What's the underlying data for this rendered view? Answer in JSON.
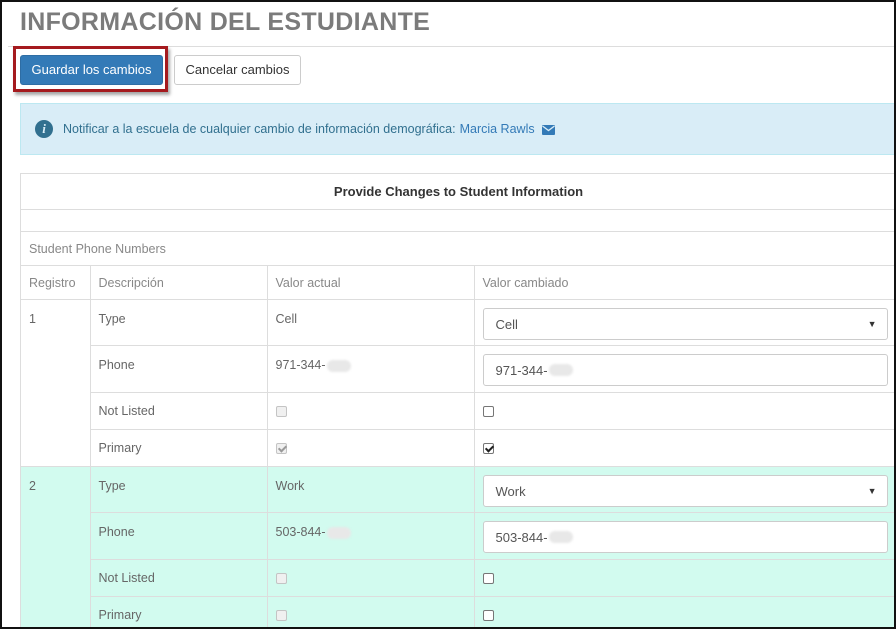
{
  "page": {
    "title": "INFORMACIÓN DEL ESTUDIANTE"
  },
  "toolbar": {
    "save_label": "Guardar los cambios",
    "cancel_label": "Cancelar cambios"
  },
  "alert": {
    "text": "Notificar a la escuela de cualquier cambio de información demográfica:",
    "contact_name": "Marcia Rawls",
    "icon": "info-icon",
    "contact_icon": "envelope-icon"
  },
  "panel": {
    "heading": "Provide Changes to Student Information",
    "section_title": "Student Phone Numbers",
    "columns": [
      "Registro",
      "Descripción",
      "Valor actual",
      "Valor cambiado"
    ]
  },
  "records": [
    {
      "number": "1",
      "type_label": "Type",
      "type_current": "Cell",
      "type_new": "Cell",
      "phone_label": "Phone",
      "phone_current": "971-344-",
      "phone_new": "971-344-",
      "not_listed_label": "Not Listed",
      "not_listed_current": false,
      "not_listed_new": false,
      "primary_label": "Primary",
      "primary_current": true,
      "primary_new": true
    },
    {
      "number": "2",
      "type_label": "Type",
      "type_current": "Work",
      "type_new": "Work",
      "phone_label": "Phone",
      "phone_current": "503-844-",
      "phone_new": "503-844-",
      "not_listed_label": "Not Listed",
      "not_listed_current": false,
      "not_listed_new": false,
      "primary_label": "Primary",
      "primary_current": false,
      "primary_new": false
    }
  ],
  "colors": {
    "primary": "#337ab7",
    "highlight_border": "#a51a1e",
    "alert_bg": "#d9edf7",
    "record_2_bg": "#d2fbef"
  }
}
